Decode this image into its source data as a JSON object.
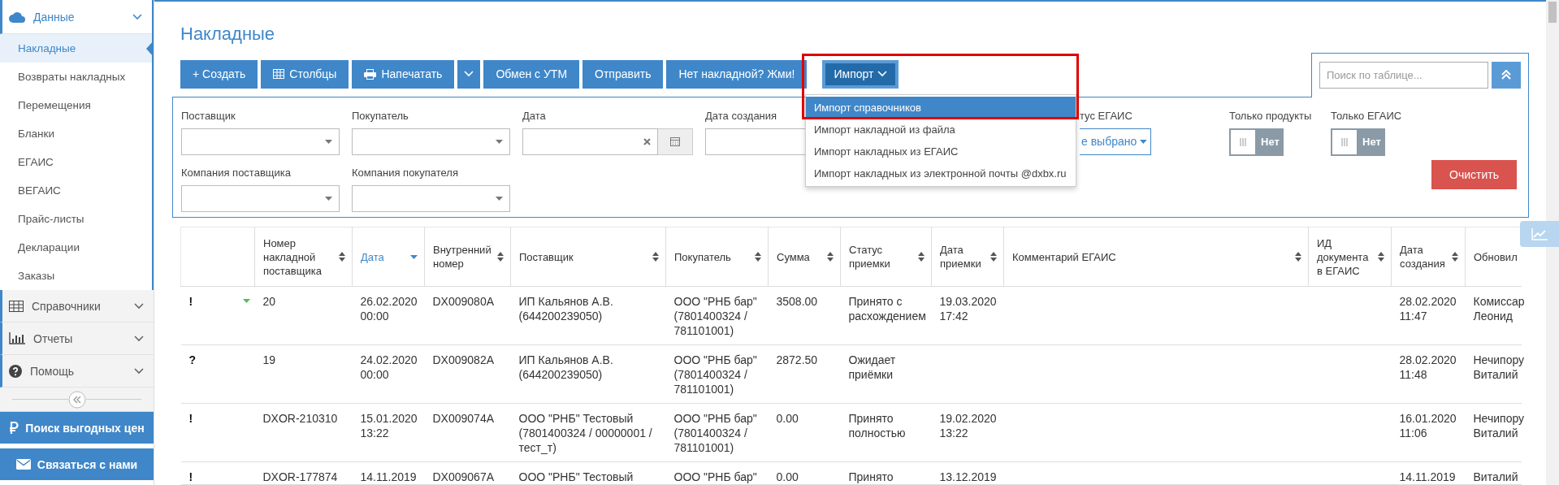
{
  "sidebar": {
    "sections": [
      {
        "label": "Данные",
        "expanded": true,
        "items": [
          {
            "label": "Накладные",
            "selected": true
          },
          {
            "label": "Возвраты накладных",
            "selected": false
          },
          {
            "label": "Перемещения",
            "selected": false
          },
          {
            "label": "Бланки",
            "selected": false
          },
          {
            "label": "ЕГАИС",
            "selected": false
          },
          {
            "label": "ВЕГАИС",
            "selected": false
          },
          {
            "label": "Прайс-листы",
            "selected": false
          },
          {
            "label": "Декларации",
            "selected": false
          },
          {
            "label": "Заказы",
            "selected": false
          }
        ]
      },
      {
        "label": "Справочники",
        "expanded": false
      },
      {
        "label": "Отчеты",
        "expanded": false
      },
      {
        "label": "Помощь",
        "expanded": false
      }
    ],
    "buttons": [
      "Поиск выгодных цен",
      "Связаться с нами"
    ]
  },
  "page": {
    "title": "Накладные"
  },
  "toolbar": [
    {
      "kind": "plain",
      "label": "+ Создать"
    },
    {
      "kind": "icon",
      "label": "Столбцы"
    },
    {
      "kind": "icon",
      "label": "Напечатать"
    },
    {
      "kind": "caret"
    },
    {
      "kind": "plain",
      "label": "Обмен с УТМ"
    },
    {
      "kind": "plain",
      "label": "Отправить"
    },
    {
      "kind": "plain",
      "label": "Нет накладной? Жми!"
    },
    {
      "kind": "menu",
      "label": "Импорт",
      "open": true
    }
  ],
  "import_menu": {
    "highlighted": true,
    "items": [
      {
        "label": "Импорт справочников",
        "selected": true
      },
      {
        "label": "Импорт накладной из файла",
        "selected": false
      },
      {
        "label": "Импорт накладных из ЕГАИС",
        "selected": false
      },
      {
        "label": "Импорт накладных из электронной почты @dxbx.ru",
        "selected": false
      }
    ]
  },
  "search": {
    "placeholder": "Поиск по таблице..."
  },
  "filters": {
    "row_1": [
      {
        "kind": "select",
        "label": "Поставщик"
      },
      {
        "kind": "select",
        "label": "Покупатель"
      },
      {
        "kind": "date",
        "label": "Дата"
      },
      {
        "kind": "text",
        "label": "Дата создания"
      },
      {
        "kind": "multiselect",
        "label": "тус ЕГАИС",
        "value": "е выбрано"
      },
      {
        "kind": "toggle",
        "label": "Только продукты",
        "on": false,
        "value": "Нет"
      },
      {
        "kind": "toggle",
        "label": "Только ЕГАИС",
        "on": false,
        "value": "Нет"
      }
    ],
    "row_2": [
      {
        "kind": "select",
        "label": "Компания поставщика"
      },
      {
        "kind": "select",
        "label": "Компания покупателя"
      }
    ],
    "clear_button": "Очистить"
  },
  "table": {
    "columns": [
      {
        "sortable": false,
        "sorted": false
      },
      {
        "label": "Номер\nнакладной\nпоставщика",
        "sortable": true,
        "sorted": false
      },
      {
        "label": "Дата",
        "sortable": true,
        "sorted": true
      },
      {
        "label": "Внутренний\nномер",
        "sortable": true,
        "sorted": false
      },
      {
        "label": "Поставщик",
        "sortable": true,
        "sorted": false
      },
      {
        "label": "Покупатель",
        "sortable": true,
        "sorted": false
      },
      {
        "label": "Сумма",
        "sortable": true,
        "sorted": false
      },
      {
        "label": "Статус\nприемки",
        "sortable": true,
        "sorted": false
      },
      {
        "label": "Дата\nприемки",
        "sortable": true,
        "sorted": false
      },
      {
        "label": "Комментарий ЕГАИС",
        "sortable": true,
        "sorted": false
      },
      {
        "label": "ИД\nдокумента\nв ЕГАИС",
        "sortable": true,
        "sorted": false
      },
      {
        "label": "Дата\nсоздания",
        "sortable": true,
        "sorted": false
      },
      {
        "label": "Обновил",
        "sorted": false
      }
    ],
    "rows": [
      {
        "details": true,
        "cells": [
          "!",
          "20",
          "26.02.2020\n00:00",
          "DX009080A",
          "ИП Кальянов А.В.\n(644200239050)",
          "ООО \"РНБ бар\"\n(7801400324 /\n781101001)",
          "3508.00",
          "Принято с\nрасхождением",
          "19.03.2020\n17:42",
          "",
          "",
          "28.02.2020\n11:47",
          "Комиссар\nЛеонид"
        ]
      },
      {
        "details": false,
        "cells": [
          "?",
          "19",
          "24.02.2020\n00:00",
          "DX009082A",
          "ИП Кальянов А.В.\n(644200239050)",
          "ООО \"РНБ бар\"\n(7801400324 /\n781101001)",
          "2872.50",
          "Ожидает\nприёмки",
          "",
          "",
          "",
          "28.02.2020\n11:48",
          "Нечипору\nВиталий"
        ]
      },
      {
        "details": false,
        "cells": [
          "!",
          "DXOR-210310",
          "15.01.2020\n13:22",
          "DX009074A",
          "ООО \"РНБ\" Тестовый\n(7801400324 / 00000001 /\nтест_т)",
          "ООО \"РНБ бар\"\n(7801400324 /\n781101001)",
          "0.00",
          "Принято\nполностью",
          "19.02.2020\n13:22",
          "",
          "",
          "16.01.2020\n11:06",
          "Нечипору\nВиталий"
        ]
      },
      {
        "details": false,
        "cells": [
          "!",
          "DXOR-177874",
          "14.11.2019",
          "DX009067A",
          "ООО \"РНБ\" Тестовый",
          "ООО \"РНБ бар\"",
          "0.00",
          "Принято",
          "13.12.2019",
          "",
          "",
          "14.11.2019",
          "Виталий"
        ]
      }
    ]
  }
}
